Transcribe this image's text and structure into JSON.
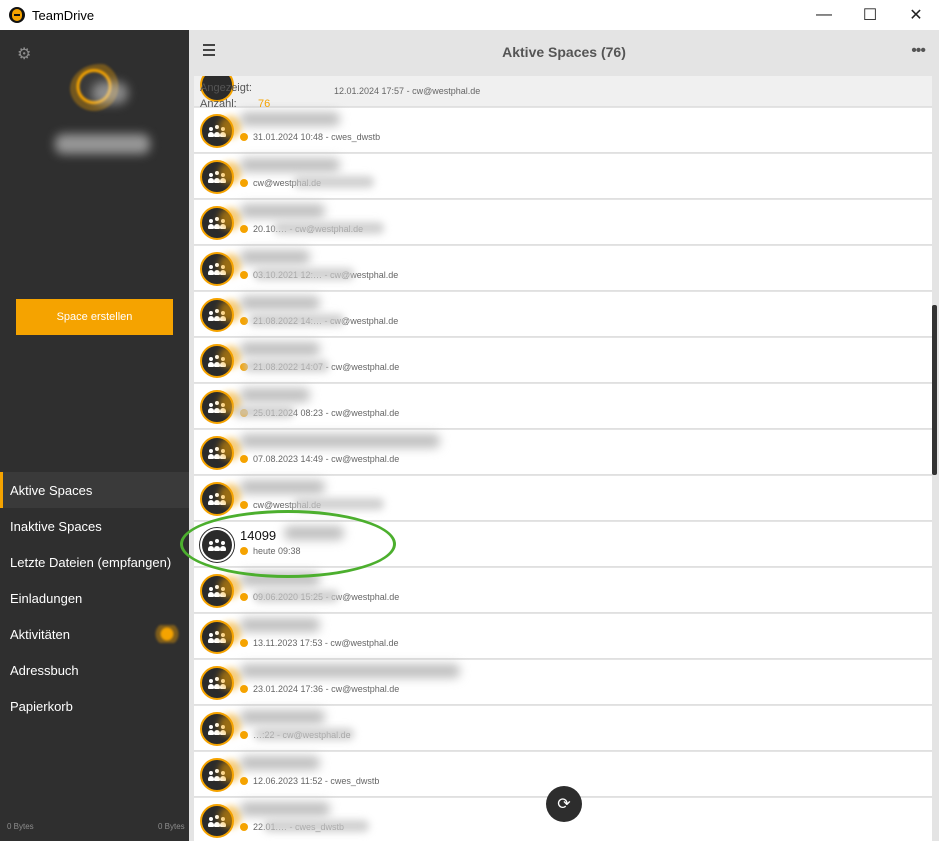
{
  "titlebar": {
    "app_title": "TeamDrive",
    "minimize": "—",
    "maximize": "☐",
    "close": "✕"
  },
  "sidebar": {
    "create_button": "Space erstellen",
    "nav": [
      {
        "label": "Aktive Spaces",
        "active": true
      },
      {
        "label": "Inaktive Spaces",
        "active": false
      },
      {
        "label": "Letzte Dateien (empfangen)",
        "active": false
      },
      {
        "label": "Einladungen",
        "active": false
      },
      {
        "label": "Aktivitäten",
        "active": false
      },
      {
        "label": "Adressbuch",
        "active": false
      },
      {
        "label": "Papierkorb",
        "active": false
      }
    ],
    "bytes_left": "0 Bytes",
    "bytes_right": "0 Bytes"
  },
  "header": {
    "title": "Aktive Spaces (76)",
    "more": "•••"
  },
  "info": {
    "shown_label": "Angezeigt:",
    "count_label": "Anzahl:",
    "count_value": "76"
  },
  "rows": [
    {
      "title": "",
      "sub": "31.01.2024 10:48 - cwes_dwstb"
    },
    {
      "title": "",
      "sub": "cw@westphal.de"
    },
    {
      "title": "",
      "sub": "20.10.… - cw@westphal.de"
    },
    {
      "title": "",
      "sub": "03.10.2021 12:… - cw@westphal.de"
    },
    {
      "title": "",
      "sub": "21.08.2022 14:… - cw@westphal.de"
    },
    {
      "title": "",
      "sub": "21.08.2022 14:07 - cw@westphal.de"
    },
    {
      "title": "",
      "sub": "25.01.2024 08:23 - cw@westphal.de"
    },
    {
      "title": "",
      "sub": "07.08.2023 14:49 - cw@westphal.de"
    },
    {
      "title": "",
      "sub": "cw@westphal.de"
    },
    {
      "title": "14099",
      "sub": "heute 09:38"
    },
    {
      "title": "",
      "sub": "09.06.2020 15:25 - cw@westphal.de"
    },
    {
      "title": "",
      "sub": "13.11.2023 17:53 - cw@westphal.de"
    },
    {
      "title": "",
      "sub": "23.01.2024 17:36 - cw@westphal.de"
    },
    {
      "title": "",
      "sub": "…:22 - cw@westphal.de"
    },
    {
      "title": "",
      "sub": "12.06.2023 11:52 - cwes_dwstb"
    },
    {
      "title": "",
      "sub": "22.01.… - cwes_dwstb"
    }
  ],
  "partial_top_row": {
    "sub": "12.01.2024 17:57 - cw@westphal.de"
  },
  "colors": {
    "accent": "#f5a300",
    "sidebar": "#2f2f2f",
    "highlight": "#4caf2e"
  },
  "icons": [
    "gear-icon",
    "hamburger-icon",
    "more-icon",
    "group-icon",
    "refresh-icon"
  ]
}
